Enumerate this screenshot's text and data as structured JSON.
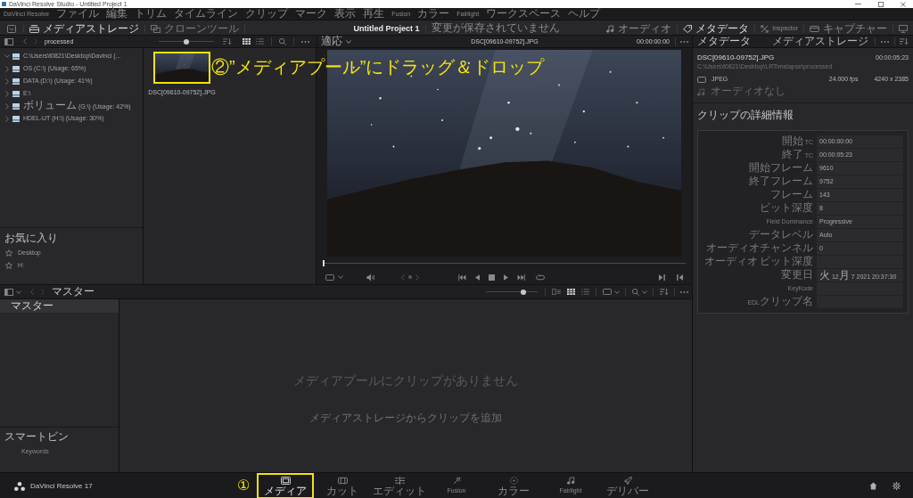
{
  "window": {
    "title": "DaVinci Resolve Studio - Untitled Project 1"
  },
  "menu": [
    "DaVinci Resolve",
    "ファイル",
    "編集",
    "トリム",
    "タイムライン",
    "クリップ",
    "マーク",
    "表示",
    "再生",
    "Fusion",
    "カラー",
    "Fairlight",
    "ワークスペース",
    "ヘルプ"
  ],
  "toolbar": {
    "left": [
      {
        "label": "メディアストレージ",
        "selected": true
      },
      {
        "label": "クローンツール",
        "selected": false
      }
    ],
    "project": "Untitled Project 1",
    "save_status": "変更が保存されていません",
    "right": [
      {
        "label": "オーディオ",
        "selected": false
      },
      {
        "label": "メタデータ",
        "selected": true
      },
      {
        "label": "Inspector",
        "selected": false
      },
      {
        "label": "キャプチャー",
        "selected": false
      }
    ]
  },
  "media_storage": {
    "location": "processed",
    "zoom_slider": {
      "level": 0.5
    },
    "view_modes": [
      {
        "selected": true
      },
      {
        "selected": false
      }
    ],
    "tree": [
      {
        "label": "C:\\Users\\t0821\\Desktop\\Davinci (...",
        "expanded": true
      },
      {
        "label": "OS (C:\\) (Usage: 65%)",
        "expanded": false
      },
      {
        "label": "DATA (D:\\) (Usage: 41%)",
        "expanded": false
      },
      {
        "label": "E:\\",
        "expanded": false
      },
      {
        "label": "ボリューム (G:\\) (Usage: 42%)",
        "expanded": false
      },
      {
        "label": "HDEL-UT (H:\\) (Usage: 30%)",
        "expanded": false
      }
    ],
    "favorites_title": "お気に入り",
    "favorites": [
      "Desktop",
      "H:"
    ],
    "clips": [
      {
        "name": "DSC[09610-09752].JPG",
        "highlighted": true
      }
    ]
  },
  "viewer": {
    "fit": "適応",
    "clip_name": "DSC[09610-09752].JPG",
    "timecode": "00:00:00:00",
    "scrubber": {
      "level": 0
    }
  },
  "metadata": {
    "title": "メタデータ",
    "source": "メディアストレージ",
    "clip_name": "DSC[09610-09752].JPG",
    "duration": "00:00:05:23",
    "path": "C:\\Users\\t0821\\Desktop\\LRTimelapse\\processed",
    "codec": "JPEG",
    "fps": "24.000 fps",
    "resolution": "4240 x 2385",
    "audio": "オーディオなし",
    "section": "クリップの詳細情報",
    "fields": [
      {
        "label": "開始 TC",
        "value": "00:00:00:00"
      },
      {
        "label": "終了 TC",
        "value": "00:00:05:23"
      },
      {
        "label": "開始フレーム",
        "value": "9610"
      },
      {
        "label": "終了フレーム",
        "value": "9752"
      },
      {
        "label": "フレーム",
        "value": "143"
      },
      {
        "label": "ビット深度",
        "value": "8"
      },
      {
        "label": "Field Dominance",
        "value": "Progressive"
      },
      {
        "label": "データレベル",
        "value": "Auto"
      },
      {
        "label": "オーディオチャンネル",
        "value": "0"
      },
      {
        "label": "オーディオ ビット深度"
      },
      {
        "label": "変更日",
        "value": "火 12月 7 2021 20:37:30"
      },
      {
        "label": "KeyKode"
      },
      {
        "label": "EDLクリップ名"
      }
    ]
  },
  "media_pool": {
    "location": "マスター",
    "zoom_slider": {
      "level": 0.75
    },
    "view_modes": [
      {
        "selected": false
      },
      {
        "selected": true
      },
      {
        "selected": false
      }
    ],
    "bins": [
      {
        "label": "マスター",
        "selected": true
      }
    ],
    "smart_bins_title": "スマートビン",
    "smart_bins": [
      "Keywords"
    ],
    "empty_message": "メディアプールにクリップがありません",
    "hint": "メディアストレージからクリップを追加"
  },
  "footer": {
    "app_name": "DaVinci Resolve 17",
    "pages": [
      {
        "label": "メディア",
        "selected": true,
        "highlighted": true
      },
      {
        "label": "カット",
        "selected": false,
        "highlighted": false
      },
      {
        "label": "エディット",
        "selected": false,
        "highlighted": false
      },
      {
        "label": "Fusion",
        "selected": false,
        "highlighted": false
      },
      {
        "label": "カラー",
        "selected": false,
        "highlighted": false
      },
      {
        "label": "Fairlight",
        "selected": false,
        "highlighted": false
      },
      {
        "label": "デリバー",
        "selected": false,
        "highlighted": false
      }
    ]
  },
  "annotations": [
    {
      "text": "②”メディアプール”にドラッグ＆ドロップ"
    },
    {
      "text": "①"
    }
  ]
}
